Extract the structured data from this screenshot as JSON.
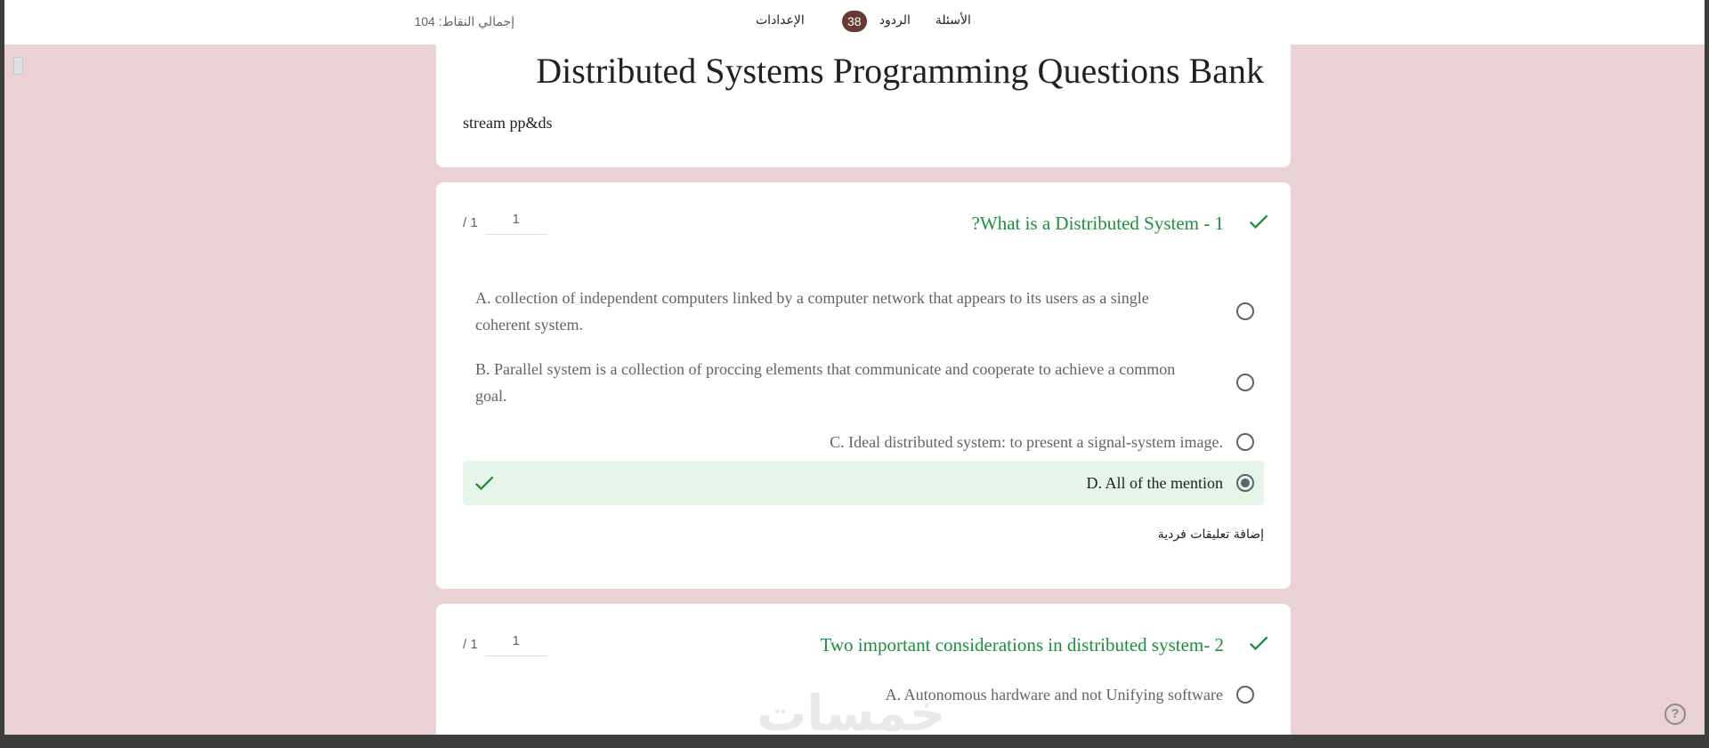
{
  "header": {
    "total_points": "إجمالي النقاط: 104",
    "tabs": [
      {
        "label": "الإعدادات"
      },
      {
        "label": "الردود",
        "badge": "38"
      },
      {
        "label": "الأسئلة"
      }
    ]
  },
  "form": {
    "title": "Distributed Systems Programming Questions Bank",
    "description": "stream pp&ds"
  },
  "questions": [
    {
      "title": "?What is a Distributed System - 1",
      "score": "1",
      "max": "/ 1",
      "options": [
        {
          "text": "A. collection of independent computers linked by a computer network that appears to its users as a single coherent system.",
          "selected": false
        },
        {
          "text": "B. Parallel system is a collection of proccing elements that communicate and cooperate to achieve a common goal.",
          "selected": false
        },
        {
          "text": "C. Ideal distributed system: to present a signal-system image.",
          "selected": false
        },
        {
          "text": "D. All of the mention",
          "selected": true,
          "correct": true
        }
      ],
      "feedback_label": "إضافة تعليقات فردية"
    },
    {
      "title": "Two important considerations in distributed system- 2",
      "score": "1",
      "max": "/ 1",
      "options": [
        {
          "text": "A. Autonomous hardware and not Unifying software",
          "selected": false
        }
      ]
    }
  ],
  "watermark": "خمسات",
  "help_label": "?",
  "colors": {
    "background": "#ead1d4",
    "accent": "#673b34",
    "correct": "#1e8e3e",
    "correct_bg": "#e6f4ea"
  }
}
